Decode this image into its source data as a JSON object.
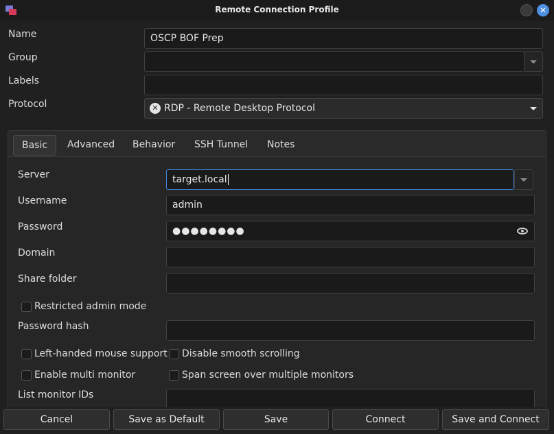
{
  "window": {
    "title": "Remote Connection Profile"
  },
  "form": {
    "name_label": "Name",
    "name_value": "OSCP BOF Prep",
    "group_label": "Group",
    "group_value": "",
    "labels_label": "Labels",
    "labels_value": "",
    "protocol_label": "Protocol",
    "protocol_value": "RDP - Remote Desktop Protocol",
    "protocol_icon": "x-circle-icon"
  },
  "tabs": [
    {
      "label": "Basic",
      "active": true
    },
    {
      "label": "Advanced",
      "active": false
    },
    {
      "label": "Behavior",
      "active": false
    },
    {
      "label": "SSH Tunnel",
      "active": false
    },
    {
      "label": "Notes",
      "active": false
    }
  ],
  "basic": {
    "server_label": "Server",
    "server_value": "target.local",
    "username_label": "Username",
    "username_value": "admin",
    "password_label": "Password",
    "password_value": "●●●●●●●●",
    "domain_label": "Domain",
    "domain_value": "",
    "share_label": "Share folder",
    "share_value": "",
    "restricted_admin_label": "Restricted admin mode",
    "restricted_admin_checked": false,
    "password_hash_label": "Password hash",
    "password_hash_value": "",
    "left_handed_label": "Left-handed mouse support",
    "left_handed_checked": false,
    "disable_smooth_label": "Disable smooth scrolling",
    "disable_smooth_checked": false,
    "multi_monitor_label": "Enable multi monitor",
    "multi_monitor_checked": false,
    "span_screen_label": "Span screen over multiple monitors",
    "span_screen_checked": false,
    "monitor_ids_label": "List monitor IDs",
    "monitor_ids_value": ""
  },
  "buttons": {
    "cancel": "Cancel",
    "save_default": "Save as Default",
    "save": "Save",
    "connect": "Connect",
    "save_connect": "Save and Connect"
  },
  "colors": {
    "accent": "#3f86e0",
    "close_button": "#4d8fe0",
    "background": "#202020"
  }
}
